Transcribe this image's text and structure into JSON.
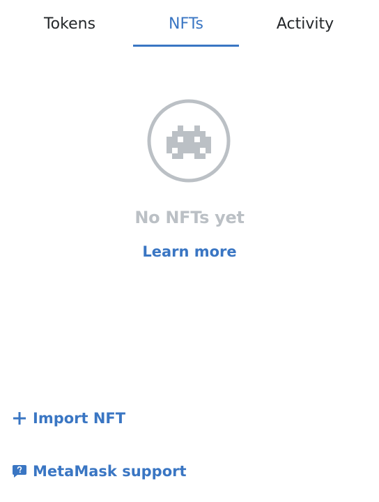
{
  "tabs": [
    {
      "label": "Tokens",
      "active": false
    },
    {
      "label": "NFTs",
      "active": true
    },
    {
      "label": "Activity",
      "active": false
    }
  ],
  "empty_state": {
    "icon": "nft-placeholder-icon",
    "title": "No NFTs yet",
    "learn_more": "Learn more"
  },
  "actions": {
    "import_nft": {
      "label": "Import NFT",
      "icon": "plus-icon"
    },
    "support": {
      "label": "MetaMask support",
      "icon": "chat-question-icon"
    }
  },
  "colors": {
    "accent": "#3a76c3",
    "text": "#24272a",
    "muted": "#bbc0c5"
  }
}
